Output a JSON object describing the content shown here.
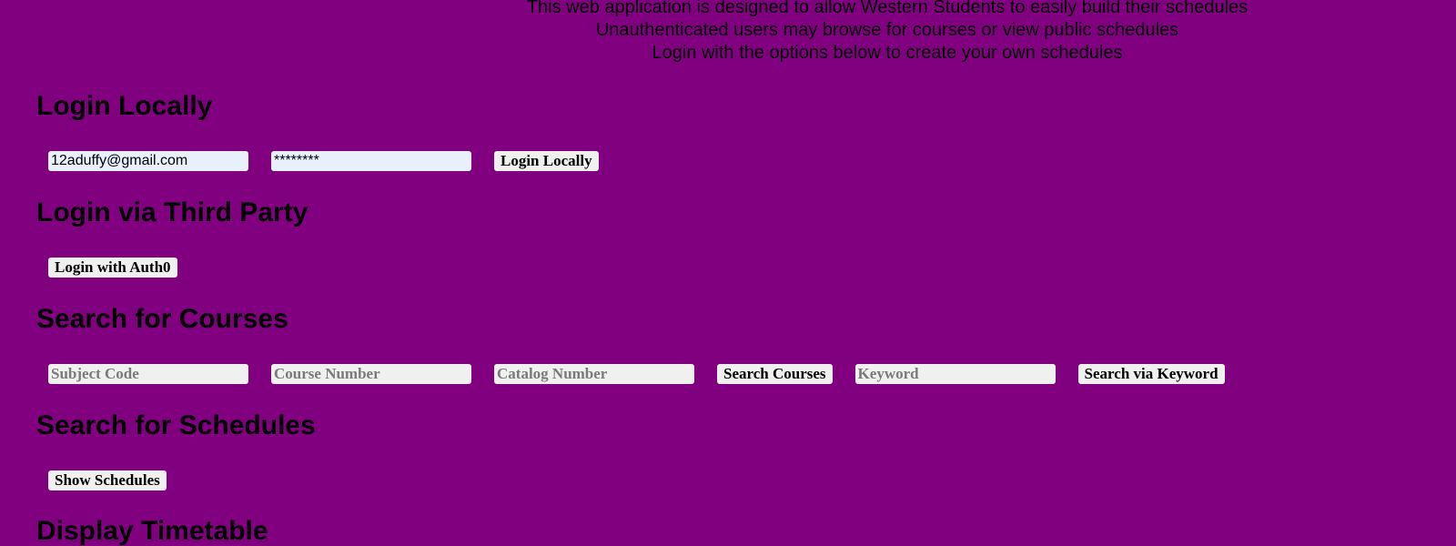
{
  "intro": {
    "line1": "This web application is designed to allow Western Students to easily build their schedules",
    "line2": "Unauthenticated users may browse for courses or view public schedules",
    "line3": "Login with the options below to create your own schedules"
  },
  "login_local": {
    "title": "Login Locally",
    "email_value": "12aduffy@gmail.com",
    "password_value": "********",
    "button_label": "Login Locally"
  },
  "login_third_party": {
    "title": "Login via Third Party",
    "button_label": "Login with Auth0"
  },
  "search_courses": {
    "title": "Search for Courses",
    "subject_placeholder": "Subject Code",
    "course_number_placeholder": "Course Number",
    "catalog_number_placeholder": "Catalog Number",
    "search_button_label": "Search Courses",
    "keyword_placeholder": "Keyword",
    "keyword_button_label": "Search via Keyword"
  },
  "search_schedules": {
    "title": "Search for Schedules",
    "button_label": "Show Schedules"
  },
  "display_timetable": {
    "title": "Display Timetable"
  },
  "colors": {
    "background": "#800080",
    "field_background": "#f0f0f0",
    "autofill_background": "#e8f0fe"
  }
}
